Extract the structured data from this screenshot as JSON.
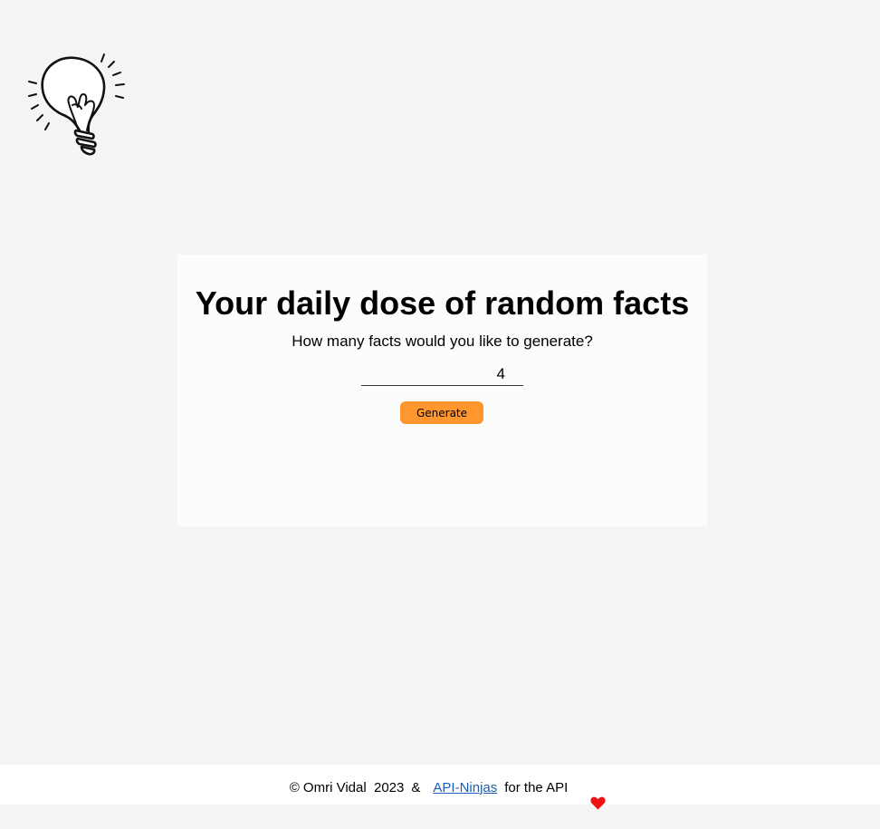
{
  "logo": {
    "icon": "lightbulb-icon"
  },
  "card": {
    "title": "Your daily dose of random facts",
    "question": "How many facts would you like to generate?",
    "count_value": "4",
    "generate_label": "Generate"
  },
  "footer": {
    "copyright": "© Omri Vidal  2023",
    "amp": "&",
    "link_text": "API-Ninjas",
    "suffix": "for the API",
    "heart_icon": "heart-icon",
    "heart_color": "#ee1111",
    "link_color": "#1a5fb4"
  },
  "colors": {
    "background": "#f5f5f5",
    "card": "#fcfcfc",
    "button": "#ff962e"
  }
}
